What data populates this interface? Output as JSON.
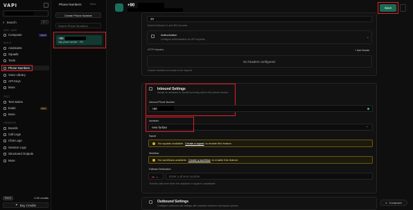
{
  "app": {
    "logo": "VAPI"
  },
  "sidebar": {
    "search_label": "Search",
    "search_kbd": "⌘ K",
    "section_top": "VAPI LABS",
    "compose": {
      "label": "Composer",
      "badge": "Alpha"
    },
    "section_build": "BUILD",
    "build": [
      "Assistants",
      "Squads",
      "Tools",
      "Phone Numbers",
      "Voice Library",
      "API Keys",
      "More"
    ],
    "section_test": "TEST",
    "test": [
      {
        "label": "Test Suites",
        "badge": ""
      },
      {
        "label": "Evals",
        "badge": "Beta"
      },
      {
        "label": "More",
        "badge": ""
      }
    ],
    "section_observe": "OBSERVE",
    "observe": [
      "Boards",
      "Call Logs",
      "Chat Logs",
      "Session Logs",
      "Structured Outputs",
      "More"
    ],
    "credits_pill": "PAYG",
    "credits_value": "0.00 credits",
    "buy_label": "Buy Credits"
  },
  "list": {
    "title": "Phone Numbers",
    "docs": "Docs",
    "create_label": "Create Phone Number",
    "search_placeholder": "Search Phone Numbers",
    "item_number": "+90",
    "item_sub": "Vapi phone number · +90"
  },
  "header": {
    "number": "+90",
    "sub": "",
    "save_label": "Save"
  },
  "main": {
    "timeout_value": "20",
    "timeout_hint": "Must be between 1 and 300 seconds",
    "auth_title": "Authorization",
    "auth_desc": "Configure authentication for API requests",
    "http_headers_label": "HTTP Headers",
    "add_header_label": "+ Add Header",
    "no_headers": "No headers configured.",
    "headers_hint": "Custom headers to include in the request",
    "inbound_title": "Inbound Settings",
    "inbound_desc": "Assign an assistant to handle incoming calls to this phone number.",
    "inbound_phone_label": "Inbound Phone Number",
    "inbound_phone_value": "+90",
    "assistant_label": "Assistant",
    "assistant_value": "new furkan",
    "squad_label": "Squad",
    "squad_warn_pre": "No squads available.",
    "squad_warn_link": "Create a squad",
    "squad_warn_post": "to enable this feature.",
    "workflow_label": "Workflow",
    "workflow_warn_pre": "No workflows available.",
    "workflow_warn_link": "Create a workflow",
    "workflow_warn_post": "to enable this feature.",
    "fallback_label": "Fallback Destination",
    "fallback_placeholder": "Enter a phone number",
    "fallback_hint": "Transfer calls here when the assistant or squad is unavailable.",
    "outbound_title": "Outbound Settings",
    "outbound_desc": "Configure outbound call settings with assistant selection and squad options."
  },
  "composer_label": "Composer",
  "colors": {
    "accent": "#1c6a55",
    "highlight_red": "#e0202a"
  }
}
